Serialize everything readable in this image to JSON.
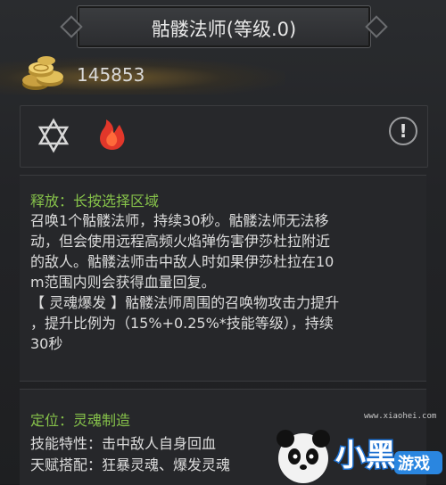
{
  "title": "骷髅法师(等级.0)",
  "gold": {
    "amount": "145853"
  },
  "icons": {
    "star": "hexagram-star-icon",
    "fire": "fire-icon",
    "info": "info-icon",
    "info_glyph": "!"
  },
  "description": {
    "release_label": "释放：长按选择区域",
    "lines": [
      "召唤1个骷髅法师，持续30秒。骷髅法师无法移",
      "动，但会使用远程高频火焰弹伤害伊莎杜拉附近",
      "的敌人。骷髅法师击中敌人时如果伊莎杜拉在10",
      "m范围内则会获得血量回复。",
      "【 灵魂爆发 】骷髅法师周围的召唤物攻击力提升",
      "，提升比例为（15%+0.25%*技能等级），持续",
      "30秒"
    ]
  },
  "info": {
    "position_label": "定位：灵魂制造",
    "trait": "技能特性：击中敌人自身回血",
    "talent": "天赋搭配：狂暴灵魂、爆发灵魂"
  },
  "watermark": {
    "brand": "小黑游戏",
    "url": "www.xiaohei.com"
  },
  "colors": {
    "green": "#86c24a",
    "text": "#dcdcdc",
    "fire": "#e2372a"
  }
}
